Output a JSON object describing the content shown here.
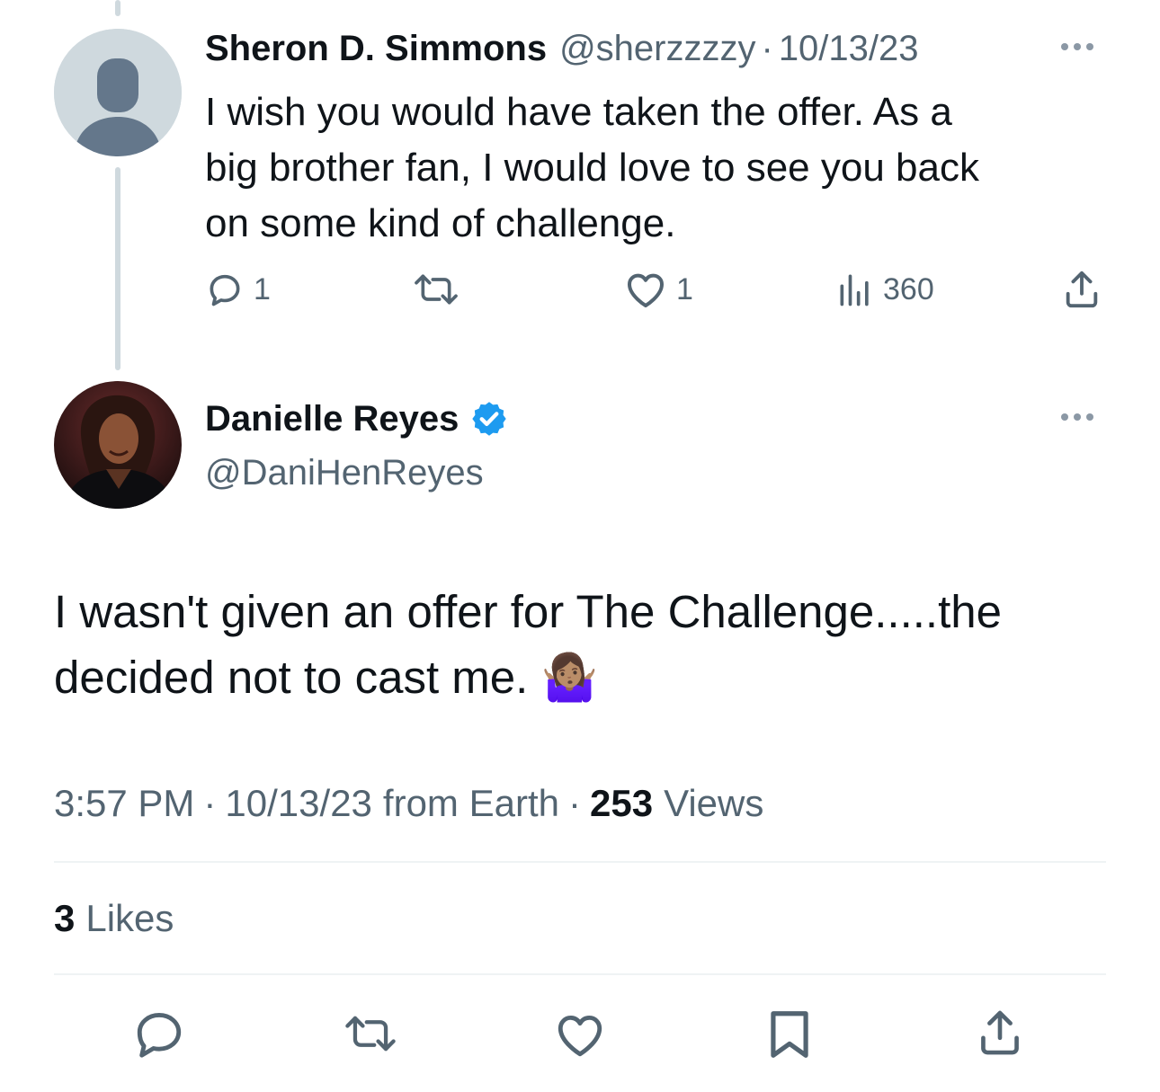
{
  "reply": {
    "name": "Sheron D. Simmons",
    "handle": "@sherzzzzy",
    "separator": "·",
    "date": "10/13/23",
    "text_lines": [
      "I wish you would have taken the offer. As a",
      "big brother fan, I would love to see you back",
      "on some kind of challenge."
    ],
    "actions": {
      "reply_count": "1",
      "retweet_count": "",
      "like_count": "1",
      "views_count": "360"
    }
  },
  "main": {
    "name": "Danielle Reyes",
    "handle": "@DaniHenReyes",
    "verified": true,
    "text_lines": [
      "I wasn't given an offer for The Challenge.....the",
      "decided not to  cast me. 🤷🏽‍♀️"
    ],
    "meta": {
      "time": "3:57 PM",
      "sep1": "·",
      "date": "10/13/23",
      "source": "from Earth",
      "sep2": "·",
      "views_number": "253",
      "views_label": "Views"
    },
    "likes_number": "3",
    "likes_label": "Likes"
  },
  "colors": {
    "text": "#0f1419",
    "muted": "#536471",
    "verified": "#1d9bf0",
    "divider": "#eff3f4"
  },
  "icons": [
    "reply-icon",
    "retweet-icon",
    "like-icon",
    "views-icon",
    "share-icon",
    "bookmark-icon",
    "more-icon",
    "verified-badge-icon"
  ]
}
